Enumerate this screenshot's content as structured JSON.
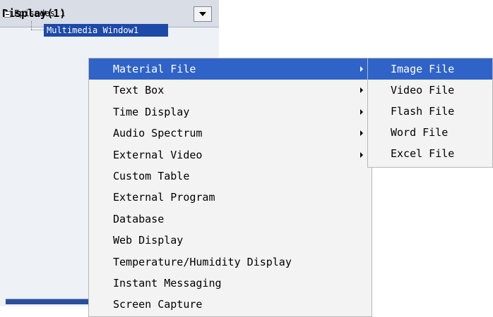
{
  "panel": {
    "title": "Display(1)",
    "tree": {
      "root": "Episodes 1",
      "child": "Multimedia Window1"
    }
  },
  "context_menu": {
    "items": [
      {
        "label": "Material File",
        "submenu": true,
        "active": true
      },
      {
        "label": "Text Box",
        "submenu": true
      },
      {
        "label": "Time Display",
        "submenu": true
      },
      {
        "label": "Audio Spectrum",
        "submenu": true
      },
      {
        "label": "External Video",
        "submenu": true
      },
      {
        "label": "Custom Table",
        "submenu": false
      },
      {
        "label": "External Program",
        "submenu": false
      },
      {
        "label": "Database",
        "submenu": false
      },
      {
        "label": "Web Display",
        "submenu": false
      },
      {
        "label": "Temperature/Humidity Display",
        "submenu": false
      },
      {
        "label": "Instant Messaging",
        "submenu": false
      },
      {
        "label": "Screen Capture",
        "submenu": false
      }
    ]
  },
  "submenu": {
    "items": [
      {
        "label": "Image File",
        "active": true
      },
      {
        "label": "Video File"
      },
      {
        "label": "Flash File"
      },
      {
        "label": "Word File"
      },
      {
        "label": "Excel File"
      }
    ]
  },
  "colors": {
    "selection": "#2f63c7",
    "tree_selection": "#1d4aa8",
    "menu_bg": "#f3f3f3"
  }
}
